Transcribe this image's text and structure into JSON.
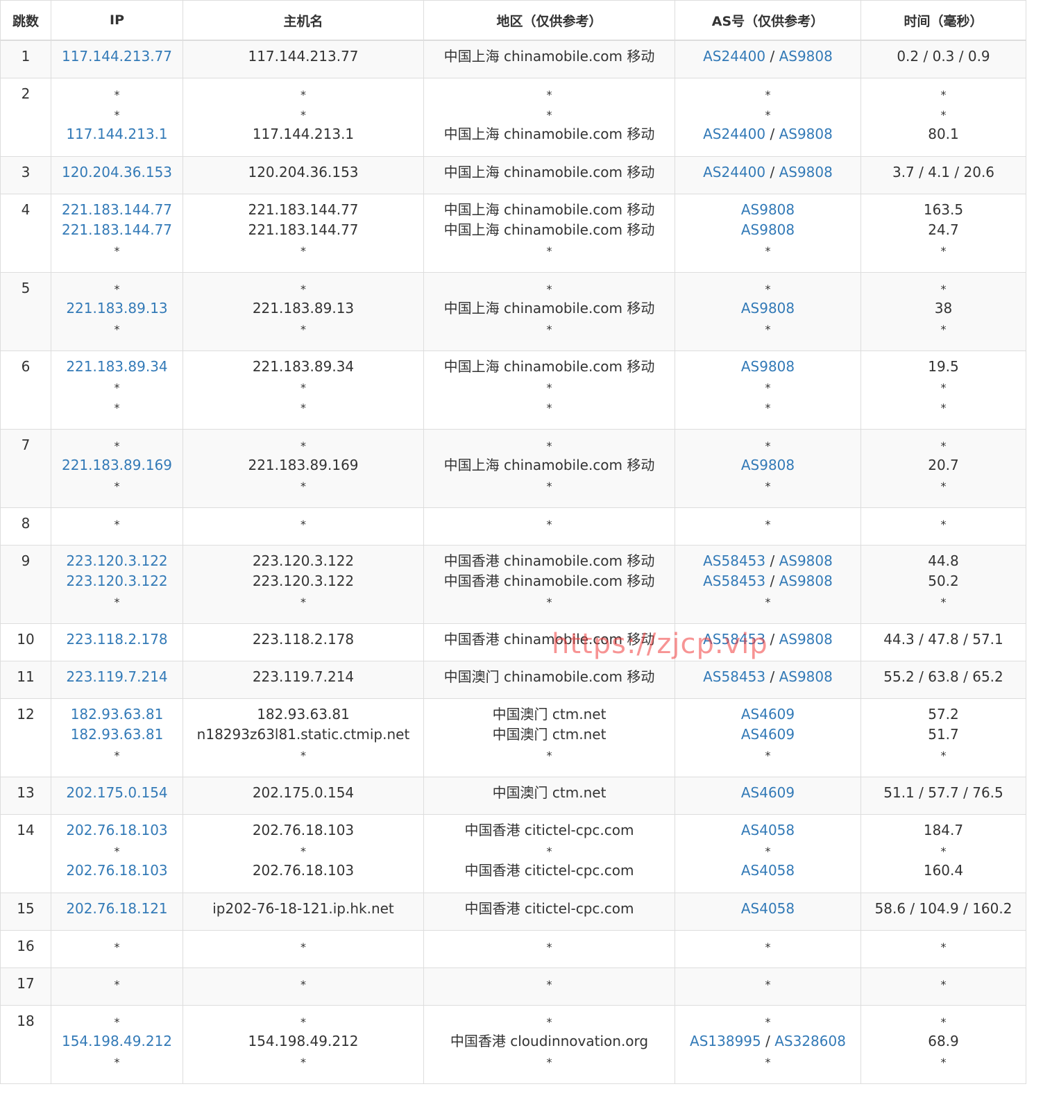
{
  "headers": [
    "跳数",
    "IP",
    "主机名",
    "地区（仅供参考）",
    "AS号（仅供参考）",
    "时间（毫秒）"
  ],
  "watermark": "https://zjcp.vip",
  "rows": [
    {
      "hop": "1",
      "lines": [
        {
          "ip": "117.144.213.77",
          "host": "117.144.213.77",
          "region": "中国上海 chinamobile.com 移动",
          "as": [
            "AS24400",
            "AS9808"
          ],
          "time": "0.2 / 0.3 / 0.9"
        }
      ]
    },
    {
      "hop": "2",
      "lines": [
        {
          "ip": "*",
          "host": "*",
          "region": "*",
          "as": [
            "*"
          ],
          "time": "*"
        },
        {
          "ip": "*",
          "host": "*",
          "region": "*",
          "as": [
            "*"
          ],
          "time": "*"
        },
        {
          "ip": "117.144.213.1",
          "host": "117.144.213.1",
          "region": "中国上海 chinamobile.com 移动",
          "as": [
            "AS24400",
            "AS9808"
          ],
          "time": "80.1"
        }
      ]
    },
    {
      "hop": "3",
      "lines": [
        {
          "ip": "120.204.36.153",
          "host": "120.204.36.153",
          "region": "中国上海 chinamobile.com 移动",
          "as": [
            "AS24400",
            "AS9808"
          ],
          "time": "3.7 / 4.1 / 20.6"
        }
      ]
    },
    {
      "hop": "4",
      "lines": [
        {
          "ip": "221.183.144.77",
          "host": "221.183.144.77",
          "region": "中国上海 chinamobile.com 移动",
          "as": [
            "AS9808"
          ],
          "time": "163.5"
        },
        {
          "ip": "221.183.144.77",
          "host": "221.183.144.77",
          "region": "中国上海 chinamobile.com 移动",
          "as": [
            "AS9808"
          ],
          "time": "24.7"
        },
        {
          "ip": "*",
          "host": "*",
          "region": "*",
          "as": [
            "*"
          ],
          "time": "*"
        }
      ]
    },
    {
      "hop": "5",
      "lines": [
        {
          "ip": "*",
          "host": "*",
          "region": "*",
          "as": [
            "*"
          ],
          "time": "*"
        },
        {
          "ip": "221.183.89.13",
          "host": "221.183.89.13",
          "region": "中国上海 chinamobile.com 移动",
          "as": [
            "AS9808"
          ],
          "time": "38"
        },
        {
          "ip": "*",
          "host": "*",
          "region": "*",
          "as": [
            "*"
          ],
          "time": "*"
        }
      ]
    },
    {
      "hop": "6",
      "lines": [
        {
          "ip": "221.183.89.34",
          "host": "221.183.89.34",
          "region": "中国上海 chinamobile.com 移动",
          "as": [
            "AS9808"
          ],
          "time": "19.5"
        },
        {
          "ip": "*",
          "host": "*",
          "region": "*",
          "as": [
            "*"
          ],
          "time": "*"
        },
        {
          "ip": "*",
          "host": "*",
          "region": "*",
          "as": [
            "*"
          ],
          "time": "*"
        }
      ]
    },
    {
      "hop": "7",
      "lines": [
        {
          "ip": "*",
          "host": "*",
          "region": "*",
          "as": [
            "*"
          ],
          "time": "*"
        },
        {
          "ip": "221.183.89.169",
          "host": "221.183.89.169",
          "region": "中国上海 chinamobile.com 移动",
          "as": [
            "AS9808"
          ],
          "time": "20.7"
        },
        {
          "ip": "*",
          "host": "*",
          "region": "*",
          "as": [
            "*"
          ],
          "time": "*"
        }
      ]
    },
    {
      "hop": "8",
      "lines": [
        {
          "ip": "*",
          "host": "*",
          "region": "*",
          "as": [
            "*"
          ],
          "time": "*"
        }
      ]
    },
    {
      "hop": "9",
      "lines": [
        {
          "ip": "223.120.3.122",
          "host": "223.120.3.122",
          "region": "中国香港 chinamobile.com 移动",
          "as": [
            "AS58453",
            "AS9808"
          ],
          "time": "44.8"
        },
        {
          "ip": "223.120.3.122",
          "host": "223.120.3.122",
          "region": "中国香港 chinamobile.com 移动",
          "as": [
            "AS58453",
            "AS9808"
          ],
          "time": "50.2"
        },
        {
          "ip": "*",
          "host": "*",
          "region": "*",
          "as": [
            "*"
          ],
          "time": "*"
        }
      ]
    },
    {
      "hop": "10",
      "lines": [
        {
          "ip": "223.118.2.178",
          "host": "223.118.2.178",
          "region": "中国香港 chinamobile.com 移动",
          "as": [
            "AS58453",
            "AS9808"
          ],
          "time": "44.3 / 47.8 / 57.1"
        }
      ]
    },
    {
      "hop": "11",
      "lines": [
        {
          "ip": "223.119.7.214",
          "host": "223.119.7.214",
          "region": "中国澳门 chinamobile.com 移动",
          "as": [
            "AS58453",
            "AS9808"
          ],
          "time": "55.2 / 63.8 / 65.2"
        }
      ]
    },
    {
      "hop": "12",
      "lines": [
        {
          "ip": "182.93.63.81",
          "host": "182.93.63.81",
          "region": "中国澳门 ctm.net",
          "as": [
            "AS4609"
          ],
          "time": "57.2"
        },
        {
          "ip": "182.93.63.81",
          "host": "n18293z63l81.static.ctmip.net",
          "region": "中国澳门 ctm.net",
          "as": [
            "AS4609"
          ],
          "time": "51.7"
        },
        {
          "ip": "*",
          "host": "*",
          "region": "*",
          "as": [
            "*"
          ],
          "time": "*"
        }
      ]
    },
    {
      "hop": "13",
      "lines": [
        {
          "ip": "202.175.0.154",
          "host": "202.175.0.154",
          "region": "中国澳门 ctm.net",
          "as": [
            "AS4609"
          ],
          "time": "51.1 / 57.7 / 76.5"
        }
      ]
    },
    {
      "hop": "14",
      "lines": [
        {
          "ip": "202.76.18.103",
          "host": "202.76.18.103",
          "region": "中国香港 citictel-cpc.com",
          "as": [
            "AS4058"
          ],
          "time": "184.7"
        },
        {
          "ip": "*",
          "host": "*",
          "region": "*",
          "as": [
            "*"
          ],
          "time": "*"
        },
        {
          "ip": "202.76.18.103",
          "host": "202.76.18.103",
          "region": "中国香港 citictel-cpc.com",
          "as": [
            "AS4058"
          ],
          "time": "160.4"
        }
      ]
    },
    {
      "hop": "15",
      "lines": [
        {
          "ip": "202.76.18.121",
          "host": "ip202-76-18-121.ip.hk.net",
          "region": "中国香港 citictel-cpc.com",
          "as": [
            "AS4058"
          ],
          "time": "58.6 / 104.9 / 160.2"
        }
      ]
    },
    {
      "hop": "16",
      "lines": [
        {
          "ip": "*",
          "host": "*",
          "region": "*",
          "as": [
            "*"
          ],
          "time": "*"
        }
      ]
    },
    {
      "hop": "17",
      "lines": [
        {
          "ip": "*",
          "host": "*",
          "region": "*",
          "as": [
            "*"
          ],
          "time": "*"
        }
      ]
    },
    {
      "hop": "18",
      "lines": [
        {
          "ip": "*",
          "host": "*",
          "region": "*",
          "as": [
            "*"
          ],
          "time": "*"
        },
        {
          "ip": "154.198.49.212",
          "host": "154.198.49.212",
          "region": "中国香港 cloudinnovation.org",
          "as": [
            "AS138995",
            "AS328608"
          ],
          "time": "68.9"
        },
        {
          "ip": "*",
          "host": "*",
          "region": "*",
          "as": [
            "*"
          ],
          "time": "*"
        }
      ]
    }
  ]
}
